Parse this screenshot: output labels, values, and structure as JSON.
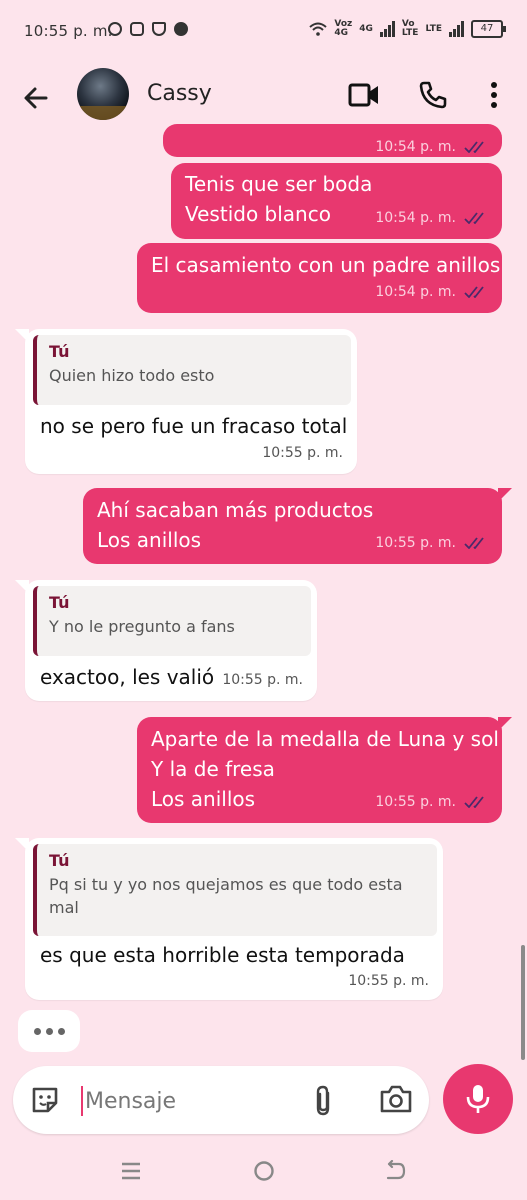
{
  "status_bar": {
    "time": "10:55 p. m.",
    "net_top_1": "Voz",
    "net_bottom_1": "4G",
    "net_top_2": "4G",
    "net_top_3": "Vo",
    "net_bottom_3": "LTE",
    "net_top_4": "LTE",
    "battery": "47"
  },
  "header": {
    "contact_name": "Cassy",
    "back_icon": "arrow-left-icon",
    "video_icon": "video-call-icon",
    "call_icon": "phone-icon",
    "more_icon": "more-vertical-icon"
  },
  "messages": [
    {
      "direction": "out",
      "lines": [],
      "time": "10:54 p. m.",
      "status": "read"
    },
    {
      "direction": "out",
      "lines": [
        "Tenis que ser boda",
        "Vestido blanco"
      ],
      "time": "10:54 p. m.",
      "status": "read"
    },
    {
      "direction": "out",
      "lines": [
        "El casamiento con un padre anillos"
      ],
      "time": "10:54 p. m.",
      "status": "read"
    },
    {
      "direction": "in",
      "quote_author": "Tú",
      "quote_text": [
        "Quien hizo todo esto"
      ],
      "lines": [
        "no se pero fue un fracaso total"
      ],
      "time": "10:55 p. m."
    },
    {
      "direction": "out",
      "lines": [
        "Ahí sacaban más productos",
        "Los anillos"
      ],
      "time": "10:55 p. m.",
      "status": "read"
    },
    {
      "direction": "in",
      "quote_author": "Tú",
      "quote_text": [
        "Y no le pregunto a fans"
      ],
      "lines": [
        "exactoo, les valió"
      ],
      "time": "10:55 p. m."
    },
    {
      "direction": "out",
      "lines": [
        "Aparte de la medalla de Luna y sol",
        "Y la de fresa",
        "Los anillos"
      ],
      "time": "10:55 p. m.",
      "status": "read"
    },
    {
      "direction": "in",
      "quote_author": "Tú",
      "quote_text": [
        "Pq si tu y yo nos quejamos es que todo esta",
        "mal"
      ],
      "lines": [
        "es que esta horrible esta temporada"
      ],
      "time": "10:55 p. m."
    }
  ],
  "composer": {
    "placeholder": "Mensaje",
    "emoji_icon": "sticker-icon",
    "attach_icon": "paperclip-icon",
    "camera_icon": "camera-icon",
    "mic_icon": "microphone-icon"
  },
  "colors": {
    "background": "#fde4ec",
    "outgoing_bubble": "#e8386f",
    "incoming_bubble": "#ffffff",
    "quote_accent": "#7a1436"
  }
}
